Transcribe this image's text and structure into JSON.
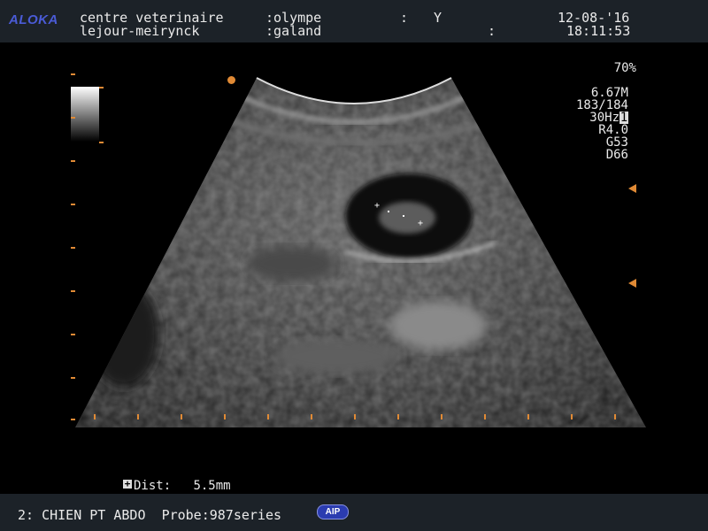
{
  "header": {
    "logo": "ALOKA",
    "clinic_line1": "centre veterinaire",
    "clinic_line2": "lejour-meirynck",
    "patient_line1": ":olympe",
    "patient_line2": ":galand",
    "sep1": ":",
    "flag": "Y",
    "sep2": ":",
    "date": "12-08-'16",
    "time": "18:11:53",
    "logo_color": "#4a5bd6"
  },
  "params": {
    "gain_percent": "70%",
    "frequency": "6.67M",
    "frame": "183/184",
    "frame_rate": "30Hz",
    "frame_rate_box": "1",
    "rejection": "R4.0",
    "gain": "G53",
    "depth": "D66"
  },
  "measurement": {
    "icon": "+",
    "label": "Dist:",
    "value": "5.5mm"
  },
  "footer": {
    "preset": "2: CHIEN PT ABDO",
    "probe": "Probe:987series",
    "badge": "AIP"
  },
  "colors": {
    "marker": "#e08a35",
    "bar_bg": "#1c2228",
    "badge_bg": "#2b3cb0"
  },
  "icons": {
    "measure_cursor": "plus-box-icon",
    "focus_marker": "triangle-left-icon",
    "transducer_marker": "orange-dot-icon"
  }
}
